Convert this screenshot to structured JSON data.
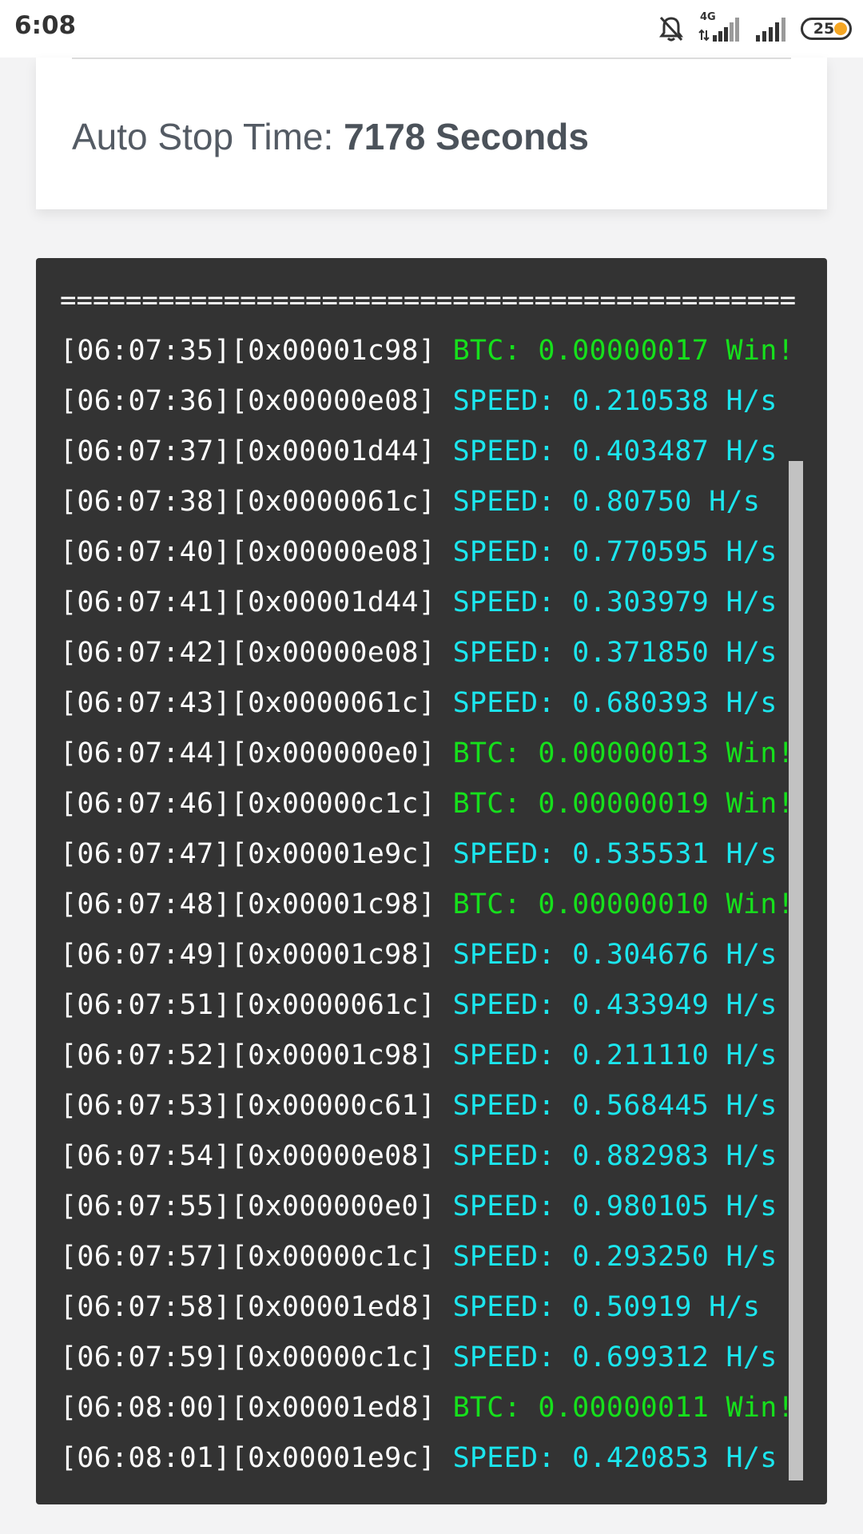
{
  "status_bar": {
    "time": "6:08",
    "network_label": "4G",
    "battery_percent": "25",
    "icons": [
      "mute-icon",
      "signal-4g-icon",
      "signal-icon",
      "battery-icon"
    ]
  },
  "info_card": {
    "auto_stop_label": "Auto Stop Time:",
    "auto_stop_value": "7178 Seconds"
  },
  "console": {
    "separator": "=============================================",
    "colors": {
      "background": "#333333",
      "text": "#ffffff",
      "speed": "#1ce6ee",
      "win": "#16e01c"
    },
    "lines": [
      {
        "prefix": "[06:07:35][0x00001c98]",
        "type": "win",
        "message": "BTC: 0.00000017 Win!"
      },
      {
        "prefix": "[06:07:36][0x00000e08]",
        "type": "speed",
        "message": "SPEED: 0.210538 H/s"
      },
      {
        "prefix": "[06:07:37][0x00001d44]",
        "type": "speed",
        "message": "SPEED: 0.403487 H/s"
      },
      {
        "prefix": "[06:07:38][0x0000061c]",
        "type": "speed",
        "message": "SPEED: 0.80750 H/s"
      },
      {
        "prefix": "[06:07:40][0x00000e08]",
        "type": "speed",
        "message": "SPEED: 0.770595 H/s"
      },
      {
        "prefix": "[06:07:41][0x00001d44]",
        "type": "speed",
        "message": "SPEED: 0.303979 H/s"
      },
      {
        "prefix": "[06:07:42][0x00000e08]",
        "type": "speed",
        "message": "SPEED: 0.371850 H/s"
      },
      {
        "prefix": "[06:07:43][0x0000061c]",
        "type": "speed",
        "message": "SPEED: 0.680393 H/s"
      },
      {
        "prefix": "[06:07:44][0x000000e0]",
        "type": "win",
        "message": "BTC: 0.00000013 Win!"
      },
      {
        "prefix": "[06:07:46][0x00000c1c]",
        "type": "win",
        "message": "BTC: 0.00000019 Win!"
      },
      {
        "prefix": "[06:07:47][0x00001e9c]",
        "type": "speed",
        "message": "SPEED: 0.535531 H/s"
      },
      {
        "prefix": "[06:07:48][0x00001c98]",
        "type": "win",
        "message": "BTC: 0.00000010 Win!"
      },
      {
        "prefix": "[06:07:49][0x00001c98]",
        "type": "speed",
        "message": "SPEED: 0.304676 H/s"
      },
      {
        "prefix": "[06:07:51][0x0000061c]",
        "type": "speed",
        "message": "SPEED: 0.433949 H/s"
      },
      {
        "prefix": "[06:07:52][0x00001c98]",
        "type": "speed",
        "message": "SPEED: 0.211110 H/s"
      },
      {
        "prefix": "[06:07:53][0x00000c61]",
        "type": "speed",
        "message": "SPEED: 0.568445 H/s"
      },
      {
        "prefix": "[06:07:54][0x00000e08]",
        "type": "speed",
        "message": "SPEED: 0.882983 H/s"
      },
      {
        "prefix": "[06:07:55][0x000000e0]",
        "type": "speed",
        "message": "SPEED: 0.980105 H/s"
      },
      {
        "prefix": "[06:07:57][0x00000c1c]",
        "type": "speed",
        "message": "SPEED: 0.293250 H/s"
      },
      {
        "prefix": "[06:07:58][0x00001ed8]",
        "type": "speed",
        "message": "SPEED: 0.50919 H/s"
      },
      {
        "prefix": "[06:07:59][0x00000c1c]",
        "type": "speed",
        "message": "SPEED: 0.699312 H/s"
      },
      {
        "prefix": "[06:08:00][0x00001ed8]",
        "type": "win",
        "message": "BTC: 0.00000011 Win!"
      },
      {
        "prefix": "[06:08:01][0x00001e9c]",
        "type": "speed",
        "message": "SPEED: 0.420853 H/s"
      }
    ]
  }
}
